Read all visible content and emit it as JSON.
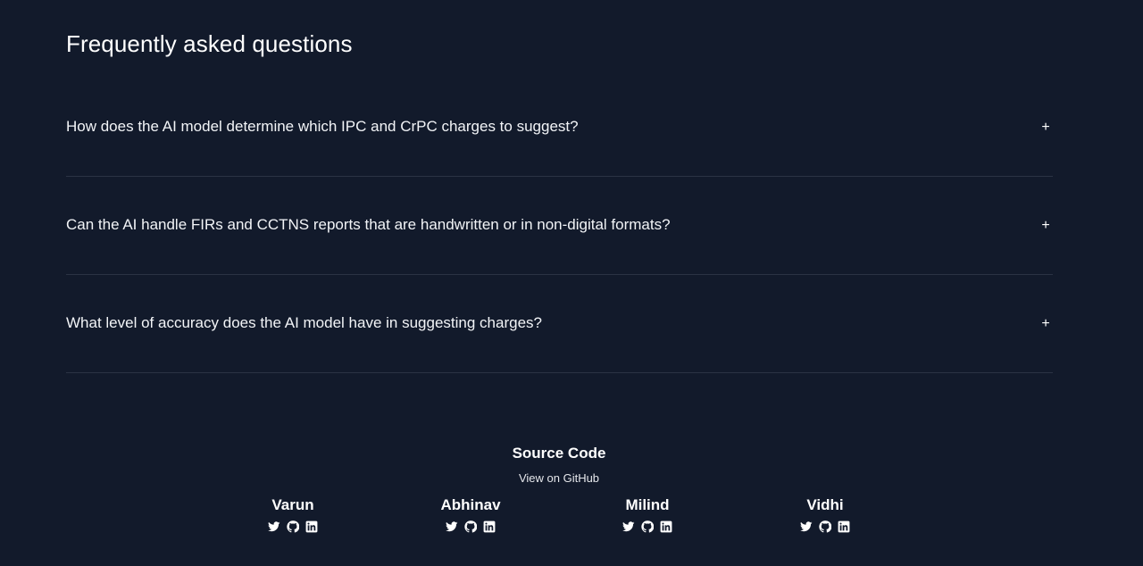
{
  "faq": {
    "title": "Frequently asked questions",
    "toggle_symbol": "+",
    "items": [
      {
        "question": "How does the AI model determine which IPC and CrPC charges to suggest?"
      },
      {
        "question": "Can the AI handle FIRs and CCTNS reports that are handwritten or in non-digital formats?"
      },
      {
        "question": "What level of accuracy does the AI model have in suggesting charges?"
      }
    ]
  },
  "footer": {
    "source_title": "Source Code",
    "source_link": "View on GitHub",
    "people": [
      {
        "name": "Varun",
        "icons": [
          "twitter-icon",
          "github-icon",
          "linkedin-icon"
        ]
      },
      {
        "name": "Abhinav",
        "icons": [
          "twitter-icon",
          "github-icon",
          "linkedin-icon"
        ]
      },
      {
        "name": "Milind",
        "icons": [
          "twitter-icon",
          "github-icon",
          "linkedin-icon"
        ]
      },
      {
        "name": "Vidhi",
        "icons": [
          "twitter-icon",
          "github-icon",
          "linkedin-icon"
        ]
      }
    ]
  },
  "colors": {
    "background": "#121a2b",
    "divider": "#2b3344",
    "text": "#ffffff"
  }
}
